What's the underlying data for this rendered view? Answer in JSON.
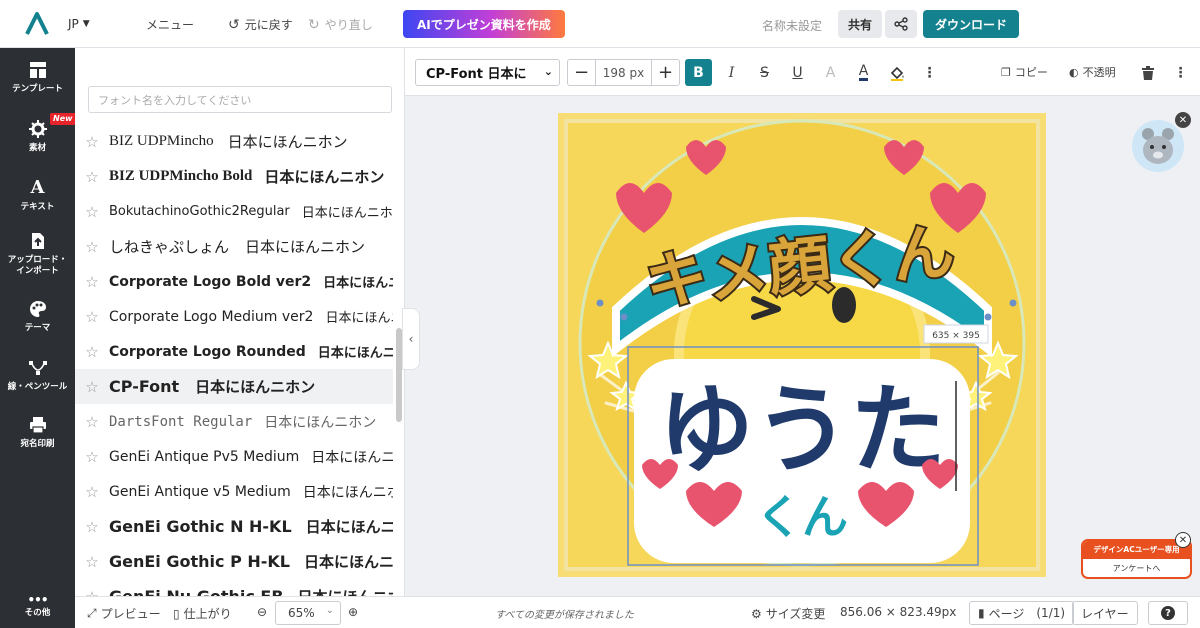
{
  "topbar": {
    "language": "JP",
    "menu_label": "メニュー",
    "undo_label": "元に戻す",
    "redo_label": "やり直し",
    "ai_button_label": "AIでプレゼン資料を作成",
    "doc_name": "名称未設定",
    "share_label": "共有",
    "download_label": "ダウンロード"
  },
  "sidebar": {
    "items": [
      {
        "label": "テンプレート",
        "icon": "template-icon"
      },
      {
        "label": "素材",
        "icon": "material-icon",
        "badge": "New"
      },
      {
        "label": "テキスト",
        "icon": "text-icon"
      },
      {
        "label": "アップロード・インポート",
        "icon": "upload-icon"
      },
      {
        "label": "テーマ",
        "icon": "palette-icon"
      },
      {
        "label": "線・ペンツール",
        "icon": "pen-tool-icon"
      },
      {
        "label": "宛名印刷",
        "icon": "printer-icon"
      },
      {
        "label": "その他",
        "icon": "more-icon"
      }
    ]
  },
  "font_panel": {
    "search_placeholder": "フォント名を入力してください",
    "fonts": [
      {
        "name": "BIZ UDPMincho",
        "sample": "日本にほんニホン"
      },
      {
        "name": "BIZ UDPMincho Bold",
        "sample": "日本にほんニホン"
      },
      {
        "name": "BokutachinoGothic2Regular",
        "sample": "日本にほんニホン"
      },
      {
        "name": "しねきゃぷしょん",
        "sample": "日本にほんニホン"
      },
      {
        "name": "Corporate Logo Bold ver2",
        "sample": "日本にほんニホン"
      },
      {
        "name": "Corporate Logo Medium ver2",
        "sample": "日本にほんニホン"
      },
      {
        "name": "Corporate Logo Rounded",
        "sample": "日本にほんニホン"
      },
      {
        "name": "CP-Font",
        "sample": "日本にほんニホン",
        "selected": true
      },
      {
        "name": "DartsFont Regular",
        "sample": "日本にほんニホン"
      },
      {
        "name": "GenEi Antique Pv5 Medium",
        "sample": "日本にほんニホン"
      },
      {
        "name": "GenEi Antique v5 Medium",
        "sample": "日本にほんニホン"
      },
      {
        "name": "GenEi Gothic N H-KL",
        "sample": "日本にほんニホン"
      },
      {
        "name": "GenEi Gothic P H-KL",
        "sample": "日本にほんニホン"
      },
      {
        "name": "GenEi Nu Gothic EB",
        "sample": "日本にほんニホン"
      }
    ]
  },
  "toolbar": {
    "font_select": "CP-Font 日本に",
    "font_size": "198 px",
    "copy_label": "コピー",
    "opacity_label": "不透明"
  },
  "canvas": {
    "title_text": "キメ顔くん",
    "name_text": "ゆうた",
    "sub_text": "くん",
    "selection_size": "635 × 395"
  },
  "statusbar": {
    "preview_label": "プレビュー",
    "finish_label": "仕上がり",
    "zoom": "65%",
    "saved_message": "すべての変更が保存されました",
    "resize_label": "サイズ変更",
    "dimensions": "856.06 × 823.49px",
    "page_label": "ページ",
    "page_count": "(1/1)",
    "layer_label": "レイヤー"
  },
  "survey": {
    "title": "デザインACユーザー専用",
    "link": "アンケートへ"
  },
  "colors": {
    "accent": "#14828e",
    "nav_bg": "#2c2f33",
    "heart": "#e8546e",
    "title_gold": "#d9a53a",
    "title_outline": "#1aa3b4",
    "name_navy": "#1f3a6b"
  }
}
